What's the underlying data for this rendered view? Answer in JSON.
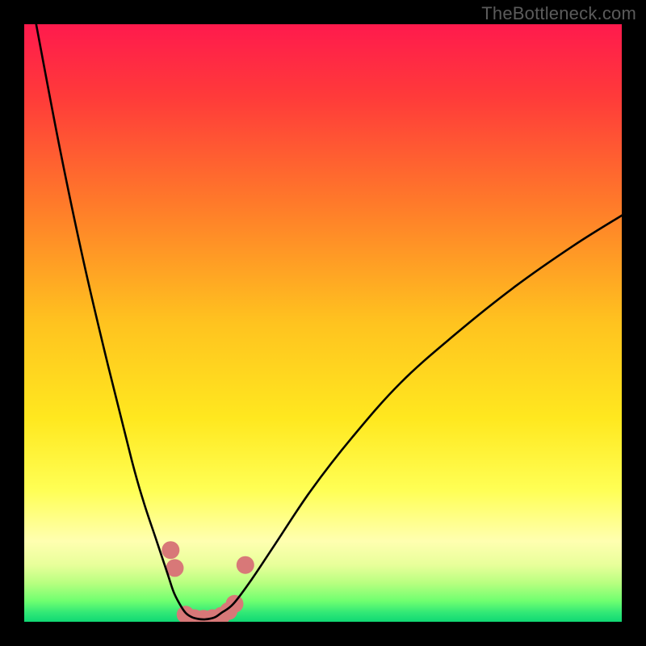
{
  "watermark": "TheBottleneck.com",
  "chart_data": {
    "type": "line",
    "title": "",
    "xlabel": "",
    "ylabel": "",
    "xlim": [
      0,
      100
    ],
    "ylim": [
      0,
      100
    ],
    "gradient_stops": [
      {
        "offset": 0.0,
        "color": "#ff1a4d"
      },
      {
        "offset": 0.12,
        "color": "#ff3a3a"
      },
      {
        "offset": 0.3,
        "color": "#ff7a2a"
      },
      {
        "offset": 0.5,
        "color": "#ffc31f"
      },
      {
        "offset": 0.66,
        "color": "#ffe81f"
      },
      {
        "offset": 0.78,
        "color": "#ffff55"
      },
      {
        "offset": 0.865,
        "color": "#ffffb0"
      },
      {
        "offset": 0.905,
        "color": "#e8ff9a"
      },
      {
        "offset": 0.935,
        "color": "#b8ff80"
      },
      {
        "offset": 0.965,
        "color": "#70ff70"
      },
      {
        "offset": 0.985,
        "color": "#30e876"
      },
      {
        "offset": 1.0,
        "color": "#10d874"
      }
    ],
    "series": [
      {
        "name": "bottleneck-curve",
        "x": [
          2,
          6,
          10,
          14,
          18,
          20,
          22,
          24,
          25,
          26,
          27,
          28,
          29,
          30,
          31,
          32,
          33,
          35,
          38,
          42,
          48,
          55,
          63,
          72,
          82,
          92,
          100
        ],
        "y": [
          100,
          79,
          60,
          43,
          27,
          20,
          14,
          8,
          5,
          3,
          1.5,
          0.8,
          0.5,
          0.4,
          0.5,
          0.8,
          1.5,
          3,
          7,
          13,
          22,
          31,
          40,
          48,
          56,
          63,
          68
        ]
      }
    ],
    "markers": {
      "name": "highlight-dots",
      "color": "#d87878",
      "radius_px": 11,
      "points": [
        {
          "x": 24.5,
          "y": 12
        },
        {
          "x": 25.2,
          "y": 9
        },
        {
          "x": 27.0,
          "y": 1.2
        },
        {
          "x": 28.5,
          "y": 0.6
        },
        {
          "x": 30.0,
          "y": 0.5
        },
        {
          "x": 31.5,
          "y": 0.6
        },
        {
          "x": 33.0,
          "y": 1.0
        },
        {
          "x": 34.2,
          "y": 1.8
        },
        {
          "x": 35.2,
          "y": 3.0
        },
        {
          "x": 37.0,
          "y": 9.5
        }
      ]
    }
  }
}
